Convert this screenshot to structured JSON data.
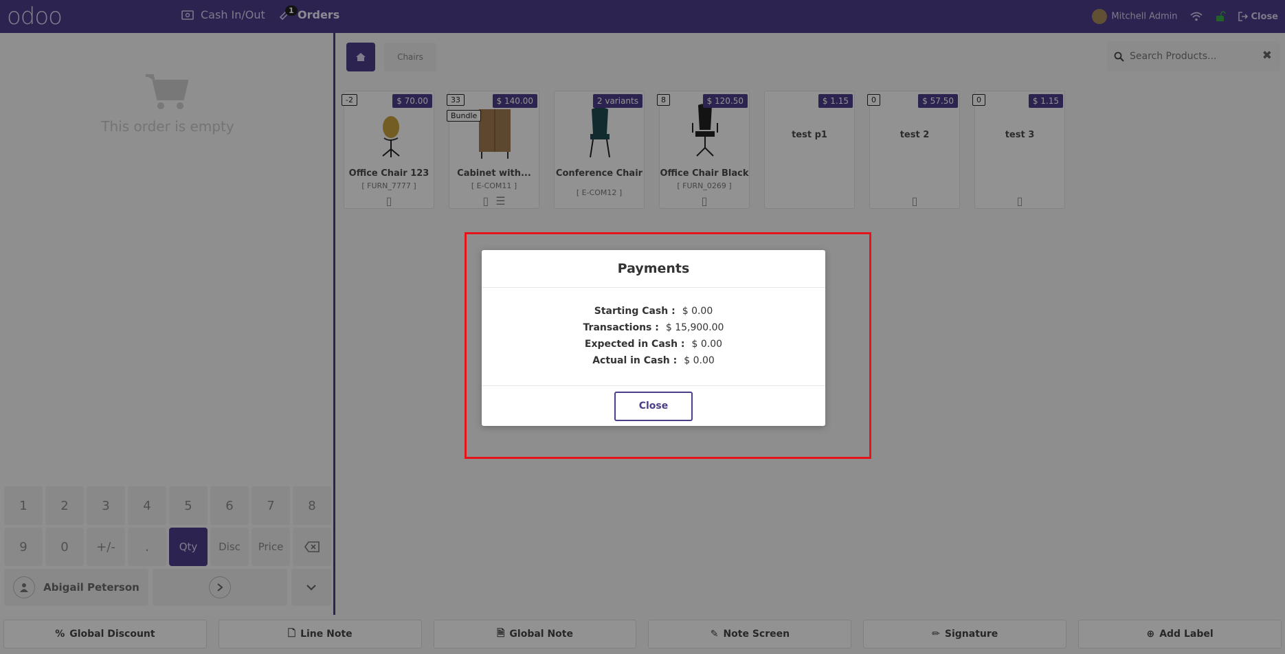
{
  "topbar": {
    "logo": "odoo",
    "cash_label": "Cash In/Out",
    "orders_label": "Orders",
    "orders_badge": "1",
    "user": "Mitchell Admin",
    "close_label": "Close"
  },
  "left": {
    "empty_text": "This order is empty",
    "keys_row1": [
      "1",
      "2",
      "3",
      "4",
      "5",
      "6",
      "7",
      "8"
    ],
    "keys_row2": [
      "9",
      "0",
      "+/-",
      ".",
      "Qty",
      "Disc",
      "Price"
    ],
    "customer": "Abigail Peterson"
  },
  "right": {
    "breadcrumb": "Chairs",
    "search_placeholder": "Search Products...",
    "products": [
      {
        "name": "Office Chair 123",
        "code": "[ FURN_7777 ]",
        "stock": "-2",
        "price": "$ 70.00"
      },
      {
        "name": "Cabinet with...",
        "code": "[ E-COM11 ]",
        "stock": "33",
        "price": "$ 140.00",
        "tag": "Bundle"
      },
      {
        "name": "Conference Chair",
        "code": "[ E-COM12 ]",
        "price": "2 variants"
      },
      {
        "name": "Office Chair Black",
        "code": "[ FURN_0269 ]",
        "stock": "8",
        "price": "$ 120.50"
      },
      {
        "name": "test p1",
        "price": "$ 1.15"
      },
      {
        "name": "test 2",
        "stock": "0",
        "price": "$ 57.50"
      },
      {
        "name": "test 3",
        "stock": "0",
        "price": "$ 1.15"
      }
    ]
  },
  "bottom": {
    "buttons": [
      "Global Discount",
      "Line Note",
      "Global Note",
      "Note Screen",
      "Signature",
      "Add Label"
    ]
  },
  "modal": {
    "title": "Payments",
    "starting_label": "Starting Cash :",
    "starting_value": "$ 0.00",
    "transactions_label": "Transactions :",
    "transactions_value": "$ 15,900.00",
    "expected_label": "Expected in Cash :",
    "expected_value": "$ 0.00",
    "actual_label": "Actual in Cash :",
    "actual_value": "$ 0.00",
    "close_label": "Close"
  }
}
